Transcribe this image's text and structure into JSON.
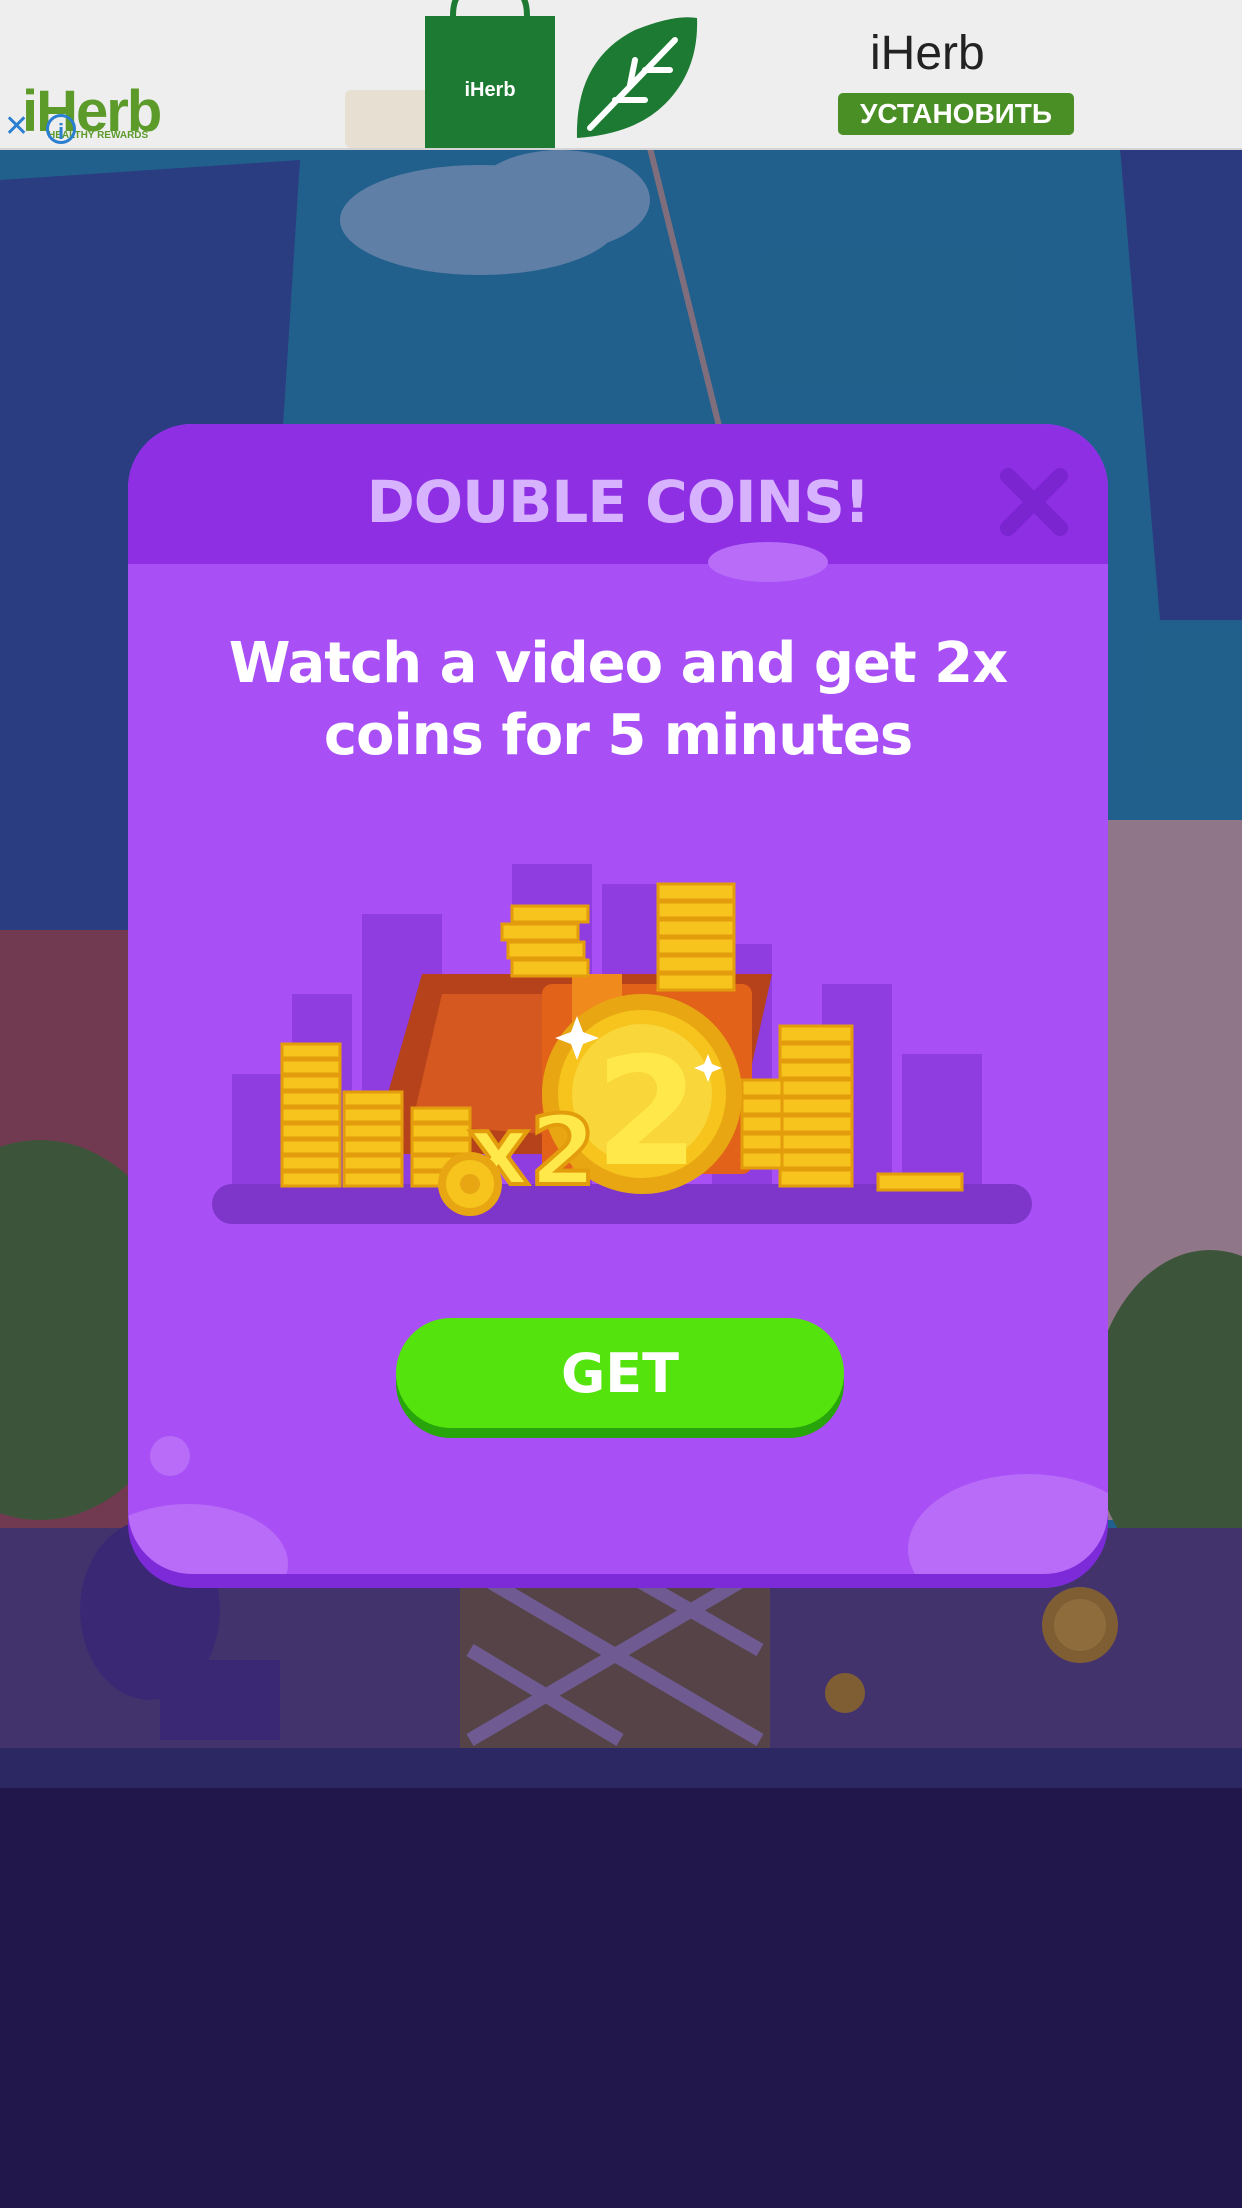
{
  "ad": {
    "logo": "iHerb",
    "logo_tagline": "HEALTHY REWARDS",
    "close_glyph": "✕",
    "info_glyph": "i",
    "bag_label": "iHerb",
    "title": "iHerb",
    "install_label": "УСТАНОВИТЬ",
    "colors": {
      "brand": "#5c9b2a",
      "button": "#4a8f25"
    }
  },
  "dialog": {
    "title": "DOUBLE COINS!",
    "message": "Watch a video and get 2x coins for 5 minutes",
    "art_label": "x2",
    "close_icon": "close-icon",
    "button_label": "GET",
    "colors": {
      "panel": "#a84ff5",
      "header": "#8e2fe3",
      "title": "#d7b3ff",
      "button": "#55e30d"
    }
  }
}
